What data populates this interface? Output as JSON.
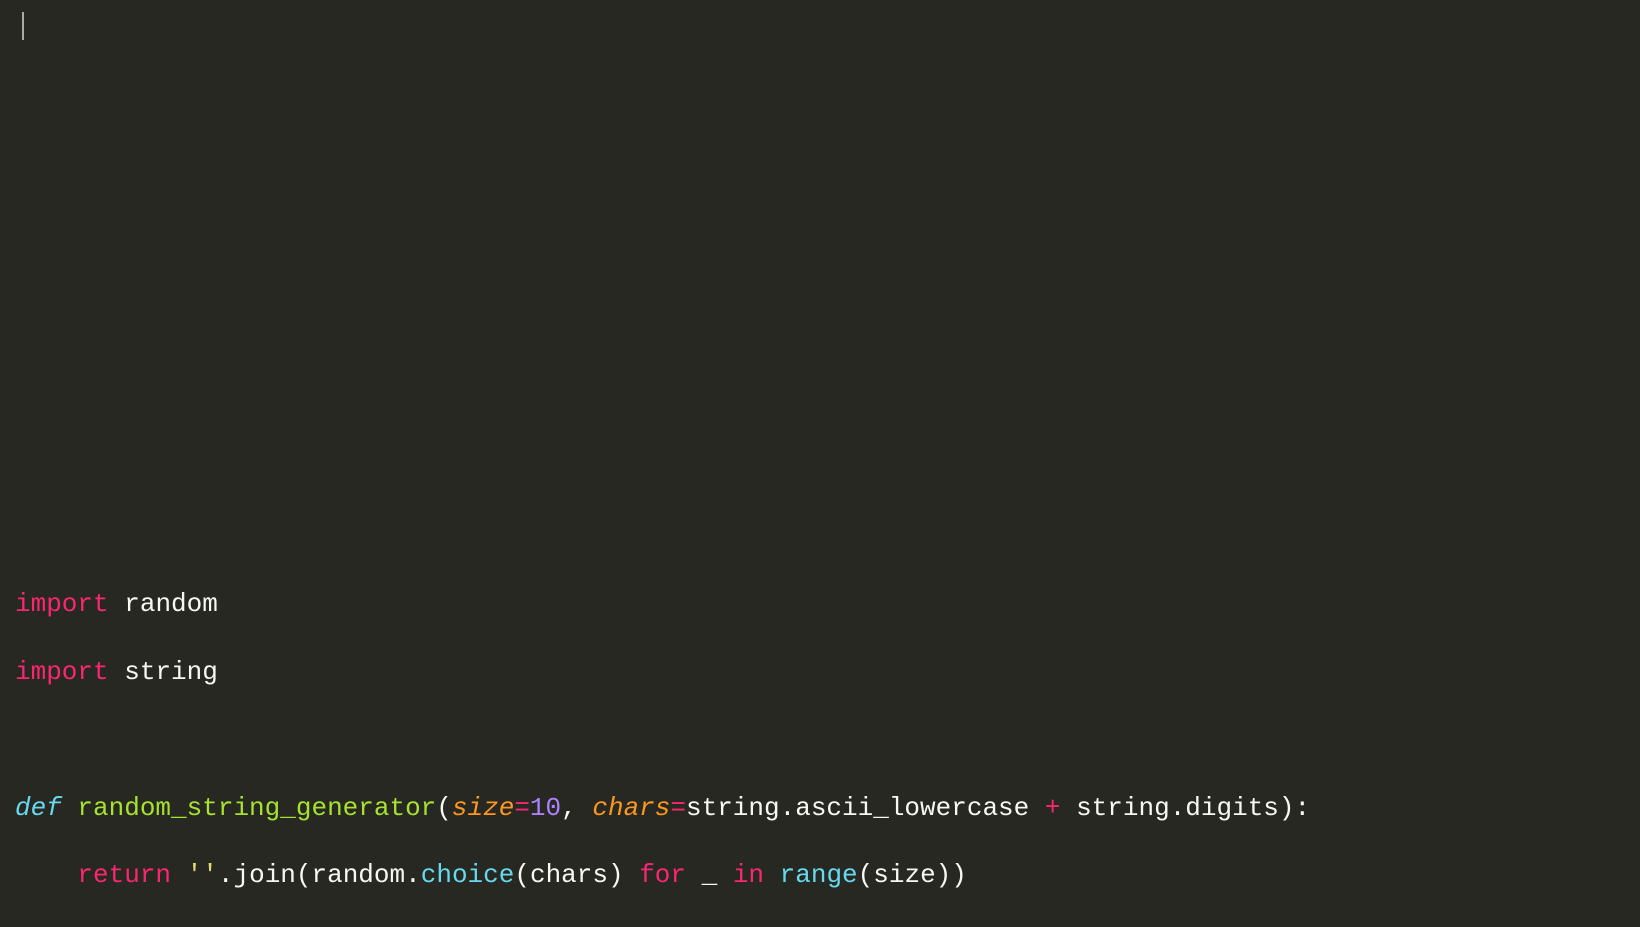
{
  "code": {
    "l1": {
      "import": "import",
      "module": "random"
    },
    "l2": {
      "import": "import",
      "module": "string"
    },
    "l3": {
      "def": "def",
      "name": "random_string_generator",
      "p1": "size",
      "v1": "10",
      "p2": "chars",
      "v2a": "string",
      "dot1": ".",
      "v2b": "ascii_lowercase ",
      "plus": "+",
      "v2c": " string",
      "dot2": ".",
      "v2d": "digits",
      "close": "):"
    },
    "l4": {
      "indent": "    ",
      "return": "return",
      "str": "''",
      "dot1": ".",
      "join": "join(",
      "mod": "random",
      "dot2": ".",
      "choice": "choice",
      "arg1": "(chars) ",
      "for": "for",
      "under": " _ ",
      "in": "in",
      "sp": " ",
      "range": "range",
      "arg2": "(size))"
    }
  }
}
